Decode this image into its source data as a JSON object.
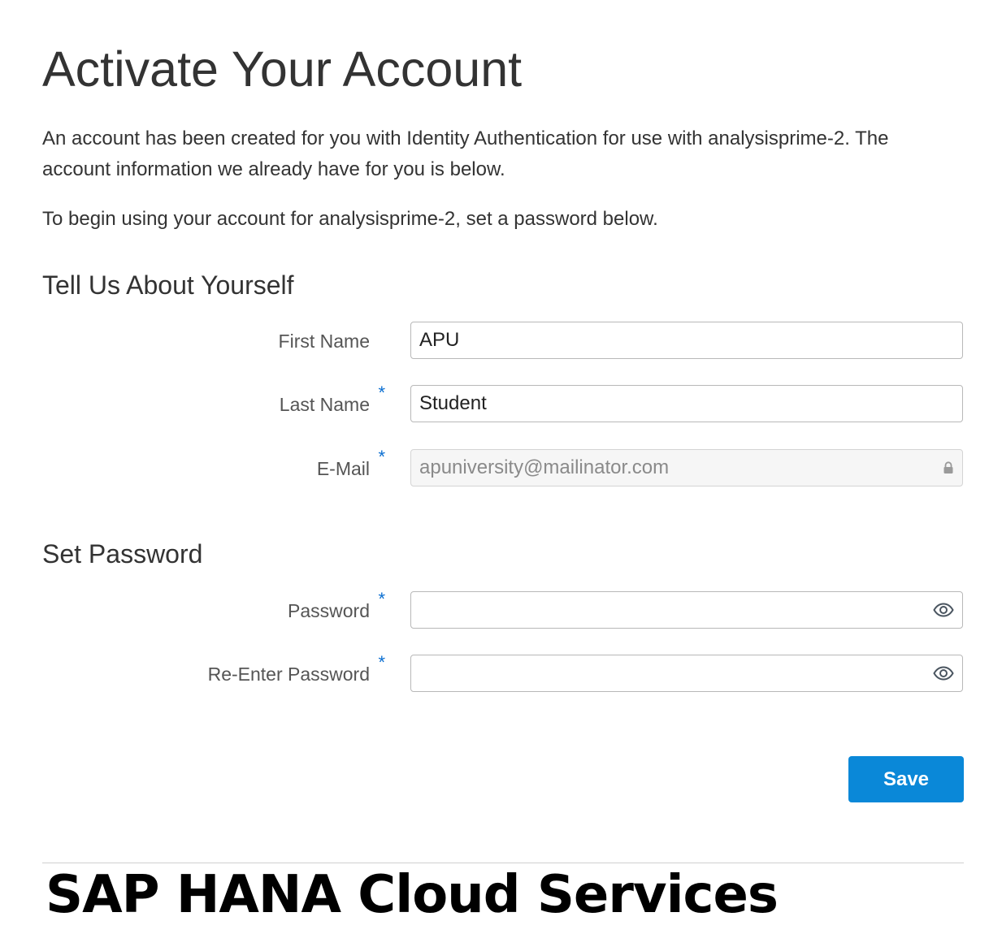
{
  "page": {
    "title": "Activate Your Account",
    "intro": "An account has been created for you with Identity Authentication for use with analysisprime-2. The account information we already have for you is below.",
    "instruction": "To begin using your account for analysisprime-2, set a password below."
  },
  "about_section": {
    "heading": "Tell Us About Yourself",
    "first_name": {
      "label": "First Name",
      "value": "APU",
      "required": false
    },
    "last_name": {
      "label": "Last Name",
      "value": "Student",
      "required_marker": "*"
    },
    "email": {
      "label": "E-Mail",
      "value": "apuniversity@mailinator.com",
      "required_marker": "*",
      "icon": "lock-icon"
    }
  },
  "password_section": {
    "heading": "Set Password",
    "password": {
      "label": "Password",
      "value": "",
      "required_marker": "*",
      "icon": "eye-icon"
    },
    "reenter_password": {
      "label": "Re-Enter Password",
      "value": "",
      "required_marker": "*",
      "icon": "eye-icon"
    }
  },
  "actions": {
    "save_label": "Save"
  },
  "footer": {
    "brand": "SAP HANA Cloud Services"
  },
  "colors": {
    "accent": "#0a88d8",
    "required": "#0a6ed1",
    "text": "#333333",
    "label": "#555555"
  }
}
